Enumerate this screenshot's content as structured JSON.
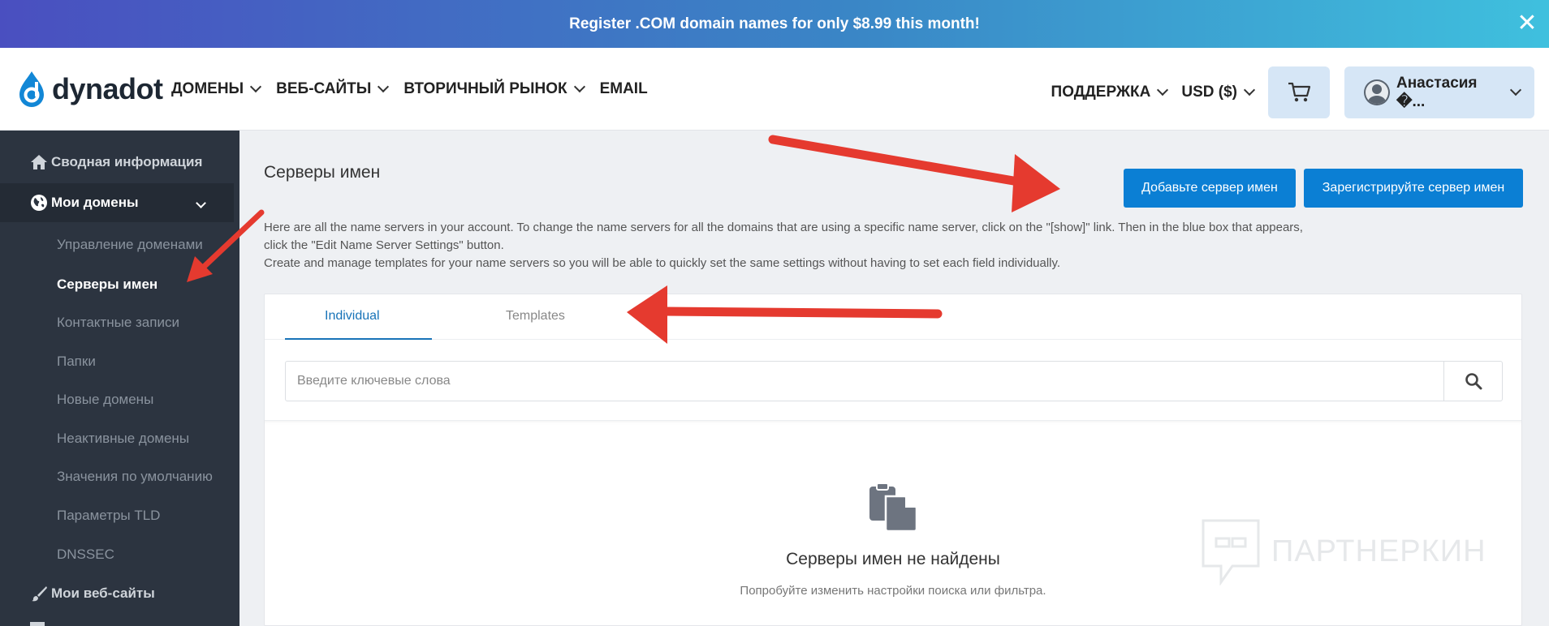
{
  "banner": {
    "text": "Register .COM domain names for only $8.99 this month!",
    "close": "✕"
  },
  "header": {
    "logo_text": "dynadot",
    "nav": [
      "ДОМЕНЫ",
      "ВЕБ-САЙТЫ",
      "ВТОРИЧНЫЙ РЫНОК",
      "EMAIL"
    ],
    "support": "ПОДДЕРЖКА",
    "currency": "USD ($)",
    "user_name": "Анастасия �..."
  },
  "sidebar": {
    "summary": "Сводная информация",
    "my_domains": "Мои домены",
    "sub_items": [
      "Управление доменами",
      "Серверы имен",
      "Контактные записи",
      "Папки",
      "Новые домены",
      "Неактивные домены",
      "Значения по умолчанию",
      "Параметры TLD",
      "DNSSEC"
    ],
    "my_websites": "Мои веб-сайты"
  },
  "main": {
    "title": "Серверы имен",
    "add_button": "Добавьте сервер имен",
    "register_button": "Зарегистрируйте сервер имен",
    "desc_line1": "Here are all the name servers in your account. To change the name servers for all the domains that are using a specific name server, click on the \"[show]\" link. Then in the blue box that appears, click the \"Edit Name Server Settings\" button.",
    "desc_line2": "Create and manage templates for your name servers so you will be able to quickly set the same settings without having to set each field individually.",
    "tabs": [
      "Individual",
      "Templates"
    ],
    "search_placeholder": "Введите ключевые слова",
    "empty_title": "Серверы имен не найдены",
    "empty_subtitle": "Попробуйте изменить настройки поиска или фильтра."
  },
  "watermark": "ПАРТНЕРКИН",
  "colors": {
    "primary": "#0b7fd4",
    "sidebar": "#2c3440",
    "annotation_arrow": "#e53a2f"
  }
}
